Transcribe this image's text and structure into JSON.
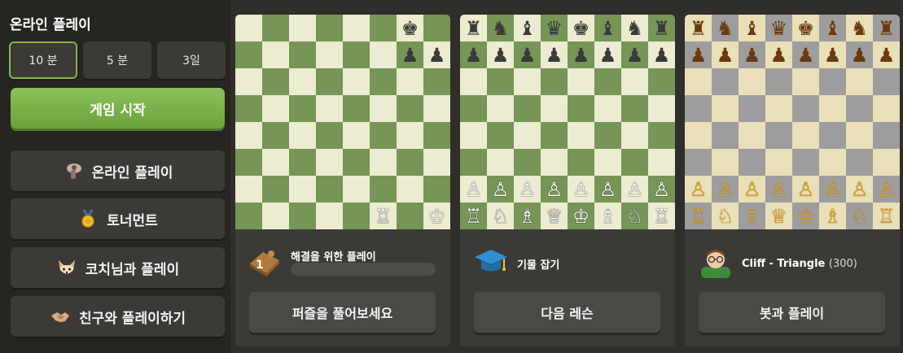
{
  "sidebar": {
    "title": "온라인 플레이",
    "time_controls": [
      {
        "label": "10 분",
        "selected": true
      },
      {
        "label": "5 분",
        "selected": false
      },
      {
        "label": "3일",
        "selected": false
      }
    ],
    "start_button": "게임 시작",
    "menu": [
      {
        "label": "온라인 플레이",
        "icon": "hand-icon"
      },
      {
        "label": "토너먼트",
        "icon": "medal-icon"
      },
      {
        "label": "코치님과 플레이",
        "icon": "fox-icon"
      },
      {
        "label": "친구와 플레이하기",
        "icon": "handshake-icon"
      }
    ]
  },
  "cards": [
    {
      "board_theme": "green",
      "title": "해결을 위한 플레이",
      "badge": "1",
      "progress": 0,
      "button": "퍼즐을 풀어보세요",
      "pieces_top": [
        "",
        "",
        "",
        "",
        "",
        "",
        "♚",
        ""
      ],
      "pieces_row2": [
        "",
        "",
        "",
        "",
        "",
        "",
        "♟",
        "♟"
      ],
      "pieces_bottom": [
        "",
        "",
        "",
        "",
        "",
        "♖",
        "",
        "♔"
      ]
    },
    {
      "board_theme": "green",
      "title": "기물 잡기",
      "button": "다음 레슨",
      "pieces_top": [
        "♜",
        "♞",
        "♝",
        "♛",
        "♚",
        "♝",
        "♞",
        "♜"
      ],
      "pieces_row2": [
        "♟",
        "♟",
        "♟",
        "♟",
        "♟",
        "♟",
        "♟",
        "♟"
      ],
      "pieces_bottom": [
        "♖",
        "♘",
        "♗",
        "♕",
        "♔",
        "♗",
        "♘",
        "♖"
      ],
      "pieces_row7": [
        "♙",
        "♙",
        "♙",
        "♙",
        "♙",
        "♙",
        "♙",
        "♙"
      ]
    },
    {
      "board_theme": "wood",
      "bot_name": "Cliff - Triangle",
      "bot_rating": "(300)",
      "button": "봇과 플레이",
      "pieces_top": [
        "♜",
        "♞",
        "♝",
        "♛",
        "♚",
        "♝",
        "♞",
        "♜"
      ],
      "pieces_row2": [
        "♟",
        "♟",
        "♟",
        "♟",
        "♟",
        "♟",
        "♟",
        "♟"
      ],
      "pieces_bottom": [
        "♖",
        "♘",
        "♗",
        "♕",
        "♔",
        "♗",
        "♘",
        "♖"
      ],
      "pieces_row7": [
        "♙",
        "♙",
        "♙",
        "♙",
        "♙",
        "♙",
        "♙",
        "♙"
      ]
    }
  ],
  "colors": {
    "accent_green": "#81b64c",
    "board_green_dark": "#779556",
    "board_green_light": "#ebecd0"
  }
}
